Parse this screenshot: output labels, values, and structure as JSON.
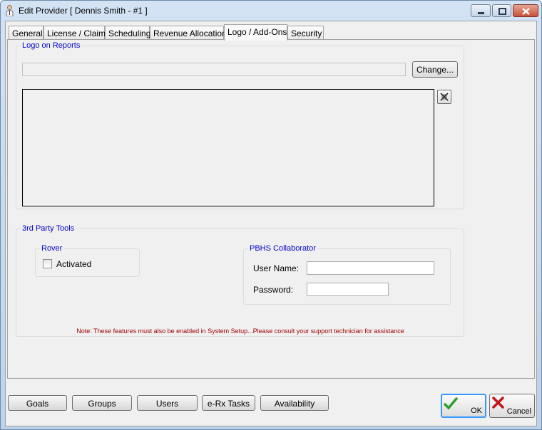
{
  "window": {
    "title": "Edit Provider  [ Dennis Smith - #1 ]",
    "controls": {
      "minimize": "minimize-icon",
      "maximize": "maximize-icon",
      "close": "close-icon"
    }
  },
  "tabs": [
    {
      "label": "General",
      "active": false
    },
    {
      "label": "License / Claims",
      "active": false
    },
    {
      "label": "Scheduling",
      "active": false
    },
    {
      "label": "Revenue Allocation",
      "active": false
    },
    {
      "label": "Logo / Add-Ons",
      "active": true
    },
    {
      "label": "Security",
      "active": false
    }
  ],
  "logo_group": {
    "title": "Logo on Reports",
    "path_value": "",
    "change_label": "Change...",
    "clear_icon": "clear-image-icon"
  },
  "tools_group": {
    "title": "3rd Party Tools",
    "rover": {
      "title": "Rover",
      "activated_label": "Activated",
      "activated": false
    },
    "collaborator": {
      "title": "PBHS Collaborator",
      "username_label": "User Name:",
      "username_value": "",
      "password_label": "Password:",
      "password_value": ""
    },
    "note": "Note: These features must also be enabled in System Setup...Please consult your support technician for assistance"
  },
  "bottom_buttons": [
    "Goals",
    "Groups",
    "Users",
    "e-Rx Tasks",
    "Availability"
  ],
  "dialog_buttons": {
    "ok": "OK",
    "cancel": "Cancel"
  },
  "colors": {
    "group_title": "#0000cc",
    "note": "#a00000",
    "ok_border": "#3399ff"
  }
}
